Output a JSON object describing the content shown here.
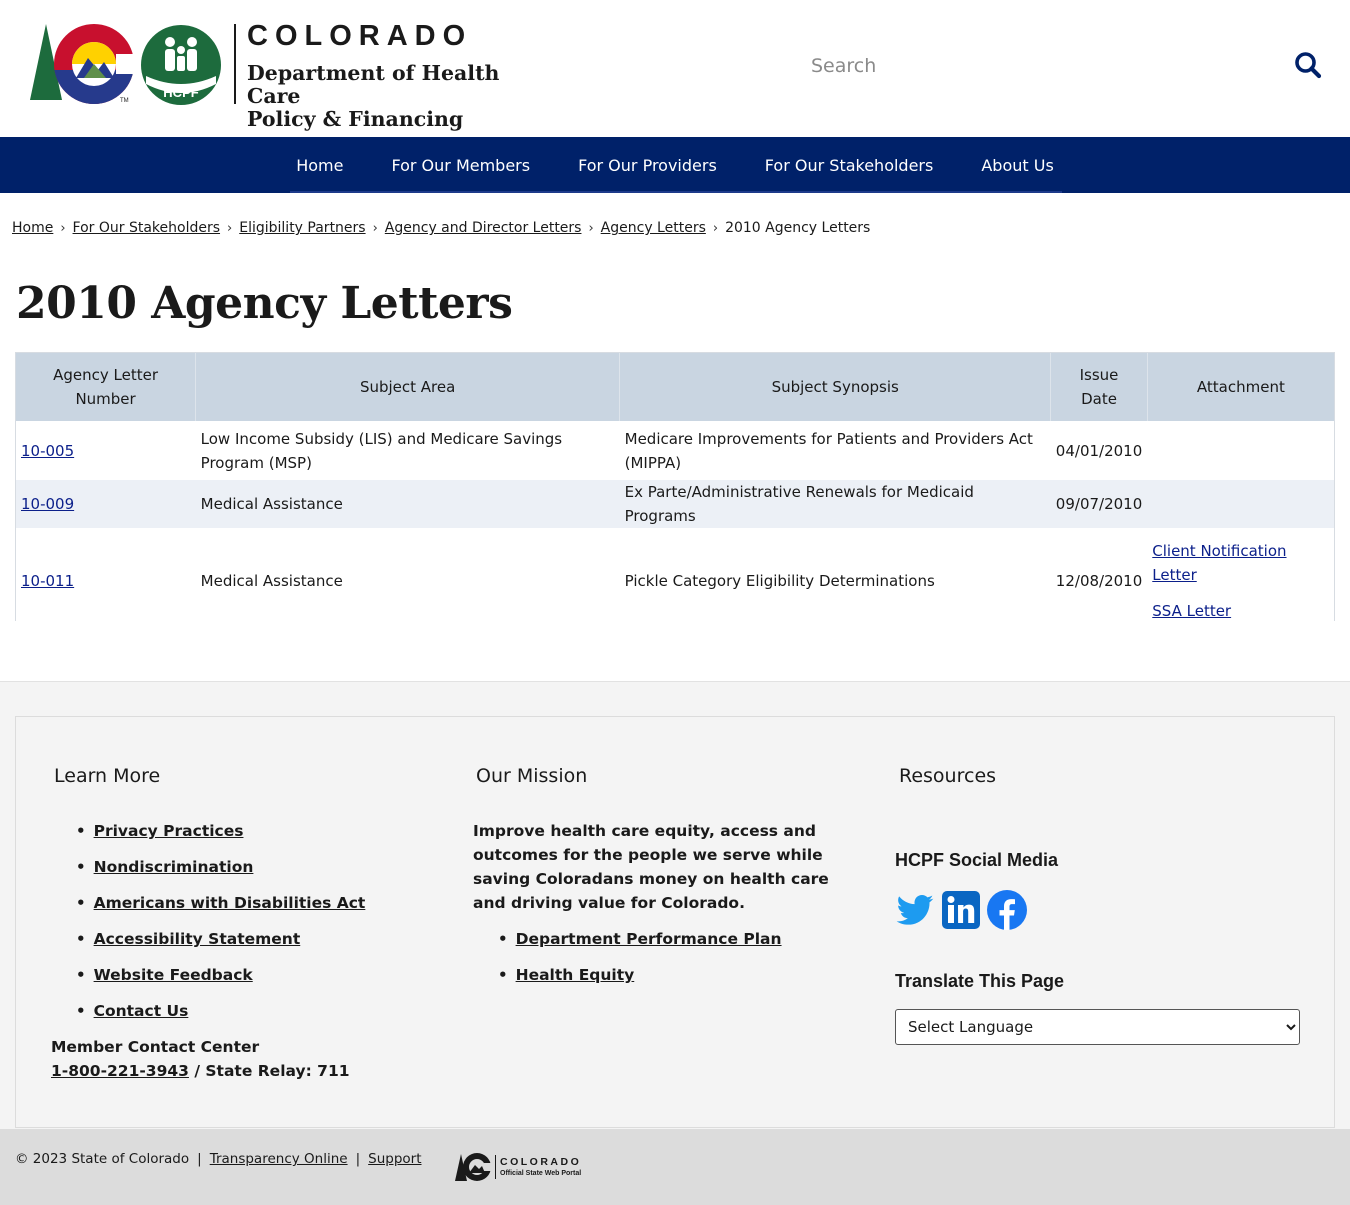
{
  "header": {
    "state_name": "COLORADO",
    "dept_line1": "Department of Health Care",
    "dept_line2": "Policy & Financing",
    "hcpf_badge": "HCPF",
    "tm": "TM",
    "search_placeholder": "Search",
    "search_icon": "search-icon",
    "colors": {
      "navy": "#002169",
      "blue": "#263a8c",
      "red": "#c8102e",
      "gold": "#ffd100",
      "green": "#1d6b3d"
    }
  },
  "nav": {
    "items": [
      {
        "label": "Home"
      },
      {
        "label": "For Our Members"
      },
      {
        "label": "For Our Providers"
      },
      {
        "label": "For Our Stakeholders"
      },
      {
        "label": "About Us"
      }
    ]
  },
  "breadcrumb": {
    "items": [
      "Home",
      "For Our Stakeholders",
      "Eligibility Partners",
      "Agency and Director Letters",
      "Agency Letters"
    ],
    "current": "2010 Agency Letters"
  },
  "page_title": "2010 Agency Letters",
  "table": {
    "headers": {
      "number_line1": "Agency Letter",
      "number_line2": "Number",
      "subject_area": "Subject Area",
      "synopsis": "Subject Synopsis",
      "date_line1": "Issue",
      "date_line2": "Date",
      "attachment": "Attachment"
    },
    "rows": [
      {
        "number": "10-005",
        "area": "Low Income Subsidy (LIS) and Medicare Savings Program (MSP)",
        "synopsis": "Medicare Improvements for Patients and Providers Act (MIPPA)",
        "date": "04/01/2010",
        "attachments": []
      },
      {
        "number": "10-009",
        "area": "Medical Assistance",
        "synopsis": "Ex Parte/Administrative Renewals for Medicaid Programs",
        "date": "09/07/2010",
        "attachments": []
      },
      {
        "number": "10-011",
        "area": "Medical Assistance",
        "synopsis": "Pickle Category Eligibility Determinations",
        "date": "12/08/2010",
        "attachments": [
          "Client Notification Letter",
          "SSA Letter"
        ]
      }
    ]
  },
  "footer": {
    "learn_more": {
      "title": "Learn More",
      "links": [
        "Privacy Practices",
        "Nondiscrimination",
        "Americans with Disabilities Act",
        "Accessibility Statement",
        "Website Feedback",
        "Contact Us"
      ],
      "contact_label": "Member Contact Center",
      "phone": "1-800-221-3943",
      "relay": " / State Relay: 711"
    },
    "mission": {
      "title": "Our Mission",
      "text": "Improve health care equity, access and outcomes for the people we serve while saving Coloradans money on health care and driving value for Colorado.",
      "links": [
        "Department Performance Plan",
        "Health Equity"
      ]
    },
    "resources": {
      "title": "Resources",
      "social_title": "HCPF Social Media",
      "social_icons": [
        "twitter-icon",
        "linkedin-icon",
        "facebook-icon"
      ],
      "translate_title": "Translate This Page",
      "language_selected": "Select Language"
    }
  },
  "bottom": {
    "copyright": "© 2023 State of Colorado",
    "links": [
      "Transparency Online",
      "Support"
    ],
    "portal_name": "COLORADO",
    "portal_sub": "Official State Web Portal"
  }
}
